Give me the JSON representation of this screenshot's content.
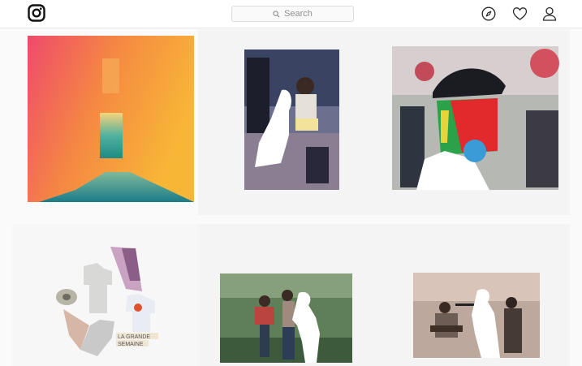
{
  "header": {
    "logo_icon": "instagram-camera-icon",
    "search": {
      "placeholder": "Search",
      "icon": "search-icon"
    },
    "nav_icons": [
      "compass-icon",
      "heart-icon",
      "profile-icon"
    ]
  },
  "posts": [
    {
      "description": "Colorful gradient artwork with mountain"
    },
    {
      "description": "Collage photo of man at piano with cut-out figure"
    },
    {
      "description": "Collage photo of person with knitted mask"
    },
    {
      "description": "Cut-out collage with t-shirts",
      "caption_line1": "LA GRANDE",
      "caption_line2": "SEMAINE"
    },
    {
      "description": "Photo of two people in park with cut-out figure"
    },
    {
      "description": "Photo of musicians with cut-out figure"
    }
  ],
  "colors": {
    "background": "#fafafa",
    "header_bg": "#ffffff",
    "border": "#dbdbdb",
    "icon": "#262626"
  }
}
